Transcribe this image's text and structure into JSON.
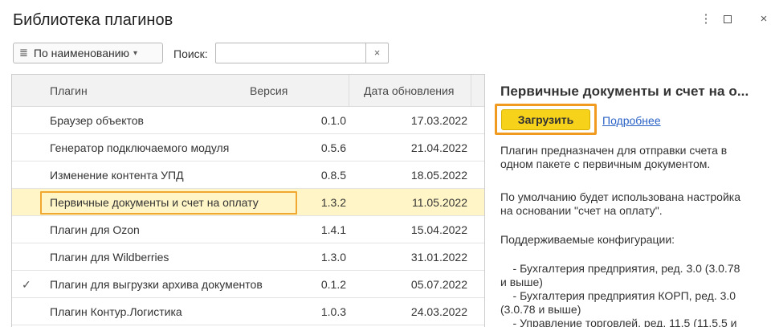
{
  "window": {
    "title": "Библиотека плагинов",
    "more_icon": "⋮",
    "close_icon": "×"
  },
  "toolbar": {
    "sort_label": "По наименованию",
    "search_label": "Поиск:",
    "search_value": "",
    "search_clear": "×"
  },
  "table": {
    "columns": [
      "Плагин",
      "Версия",
      "Дата обновления"
    ],
    "rows": [
      {
        "checked": "",
        "name": "Браузер объектов",
        "version": "0.1.0",
        "date": "17.03.2022"
      },
      {
        "checked": "",
        "name": "Генератор подключаемого модуля",
        "version": "0.5.6",
        "date": "21.04.2022"
      },
      {
        "checked": "",
        "name": "Изменение контента УПД",
        "version": "0.8.5",
        "date": "18.05.2022"
      },
      {
        "checked": "",
        "name": "Первичные документы и счет на оплату",
        "version": "1.3.2",
        "date": "11.05.2022",
        "selected": true
      },
      {
        "checked": "",
        "name": "Плагин для Ozon",
        "version": "1.4.1",
        "date": "15.04.2022"
      },
      {
        "checked": "",
        "name": "Плагин для Wildberries",
        "version": "1.3.0",
        "date": "31.01.2022"
      },
      {
        "checked": "✓",
        "name": "Плагин для выгрузки архива документов",
        "version": "0.1.2",
        "date": "05.07.2022"
      },
      {
        "checked": "",
        "name": "Плагин Контур.Логистика",
        "version": "1.0.3",
        "date": "24.03.2022"
      }
    ]
  },
  "details": {
    "title": "Первичные документы и счет на о...",
    "load_button": "Загрузить",
    "more_link": "Подробнее",
    "desc1": "Плагин предназначен для отправки счета в\nодном пакете с первичным документом.",
    "desc2": "По умолчанию будет использована настройка\nна основании \"счет на оплату\".",
    "desc3": "Поддерживаемые конфигурации:",
    "desc4": "    - Бухгалтерия предприятия, ред. 3.0 (3.0.78\nи выше)\n    - Бухгалтерия предприятия КОРП, ред. 3.0\n(3.0.78 и выше)\n    - Управление торговлей, ред. 11.5 (11.5.5 и"
  },
  "colors": {
    "selected_row": "#fff5c7",
    "highlight_outline": "#f0a830",
    "load_button": "#f7d21a",
    "link": "#2a62c5"
  }
}
